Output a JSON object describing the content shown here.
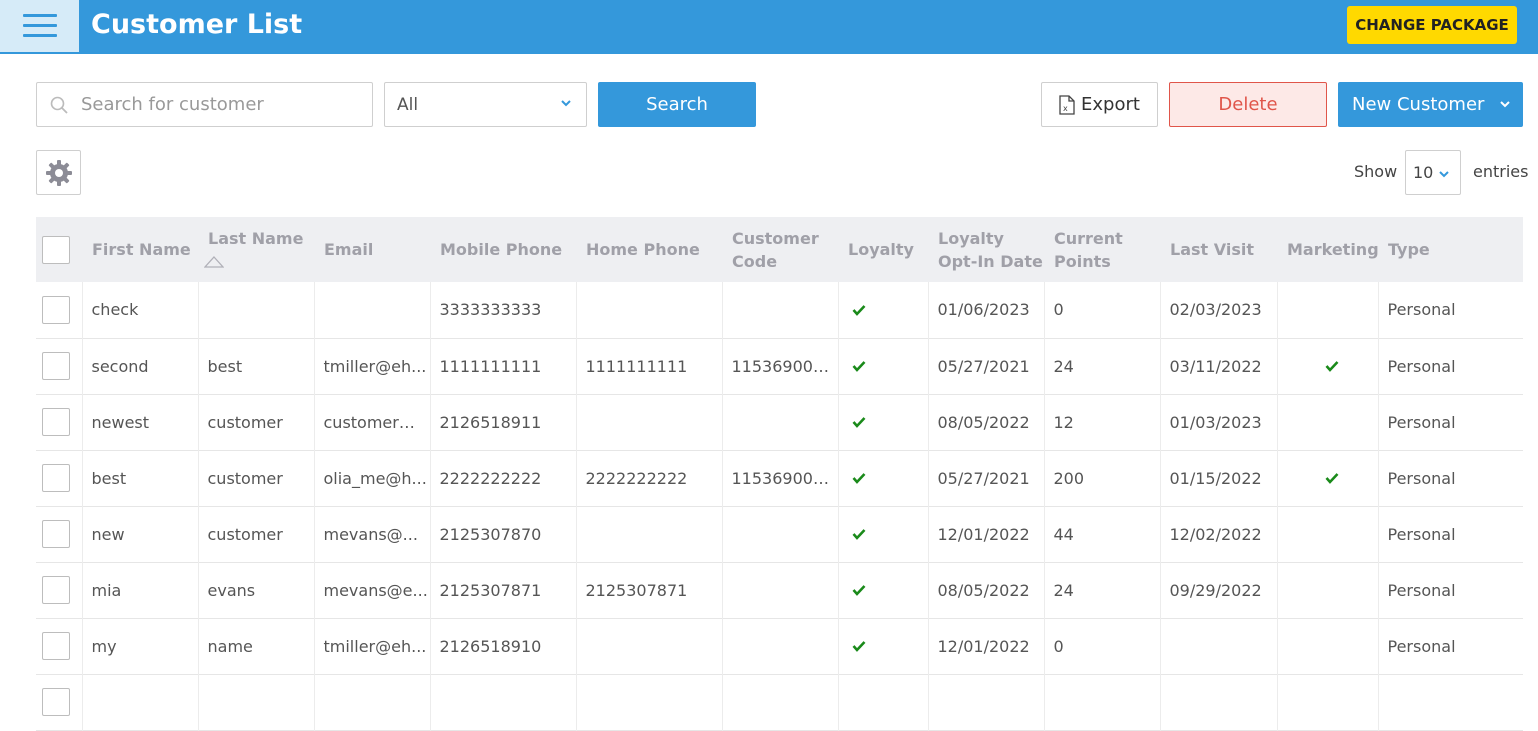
{
  "header": {
    "title": "Customer List",
    "change_package": "CHANGE PACKAGE"
  },
  "toolbar": {
    "search_placeholder": "Search for customer",
    "filter_value": "All",
    "search_label": "Search",
    "export_label": "Export",
    "delete_label": "Delete",
    "new_customer_label": "New Customer"
  },
  "paging": {
    "show_label": "Show",
    "page_size": "10",
    "entries_label": "entries"
  },
  "colors": {
    "primary": "#3498db",
    "accent_yellow": "#ffd900",
    "danger": "#e0554a",
    "check_green": "#1a8a1a"
  },
  "table": {
    "columns": [
      {
        "label": "First Name",
        "sorted": false
      },
      {
        "label": "Last Name",
        "sorted": true
      },
      {
        "label": "Email",
        "sorted": false
      },
      {
        "label": "Mobile Phone",
        "sorted": false
      },
      {
        "label": "Home Phone",
        "sorted": false
      },
      {
        "label": "Customer Code",
        "sorted": false
      },
      {
        "label": "Loyalty",
        "sorted": false
      },
      {
        "label": "Loyalty Opt-In Date",
        "sorted": false
      },
      {
        "label": "Current Points",
        "sorted": false
      },
      {
        "label": "Last Visit",
        "sorted": false
      },
      {
        "label": "Marketing",
        "sorted": false
      },
      {
        "label": "Type",
        "sorted": false
      }
    ],
    "rows": [
      {
        "first": "check",
        "last": "",
        "email": "",
        "mobile": "3333333333",
        "home": "",
        "code": "",
        "loyalty": true,
        "optin": "01/06/2023",
        "points": "0",
        "last_visit": "02/03/2023",
        "marketing": false,
        "type": "Personal"
      },
      {
        "first": "second",
        "last": "best",
        "email": "tmiller@eh...",
        "mobile": "1111111111",
        "home": "1111111111",
        "code": "115369000...",
        "loyalty": true,
        "optin": "05/27/2021",
        "points": "24",
        "last_visit": "03/11/2022",
        "marketing": true,
        "type": "Personal"
      },
      {
        "first": "newest",
        "last": "customer",
        "email": "customer@...",
        "mobile": "2126518911",
        "home": "",
        "code": "",
        "loyalty": true,
        "optin": "08/05/2022",
        "points": "12",
        "last_visit": "01/03/2023",
        "marketing": false,
        "type": "Personal"
      },
      {
        "first": "best",
        "last": "customer",
        "email": "olia_me@h...",
        "mobile": "2222222222",
        "home": "2222222222",
        "code": "115369000...",
        "loyalty": true,
        "optin": "05/27/2021",
        "points": "200",
        "last_visit": "01/15/2022",
        "marketing": true,
        "type": "Personal"
      },
      {
        "first": "new",
        "last": "customer",
        "email": "mevans@...",
        "mobile": "2125307870",
        "home": "",
        "code": "",
        "loyalty": true,
        "optin": "12/01/2022",
        "points": "44",
        "last_visit": "12/02/2022",
        "marketing": false,
        "type": "Personal"
      },
      {
        "first": "mia",
        "last": "evans",
        "email": "mevans@e...",
        "mobile": "2125307871",
        "home": "2125307871",
        "code": "",
        "loyalty": true,
        "optin": "08/05/2022",
        "points": "24",
        "last_visit": "09/29/2022",
        "marketing": false,
        "type": "Personal"
      },
      {
        "first": "my",
        "last": "name",
        "email": "tmiller@eh...",
        "mobile": "2126518910",
        "home": "",
        "code": "",
        "loyalty": true,
        "optin": "12/01/2022",
        "points": "0",
        "last_visit": "",
        "marketing": false,
        "type": "Personal"
      },
      {
        "first": "",
        "last": "",
        "email": "",
        "mobile": "",
        "home": "",
        "code": "",
        "loyalty": false,
        "optin": "",
        "points": "",
        "last_visit": "",
        "marketing": false,
        "type": ""
      }
    ]
  }
}
